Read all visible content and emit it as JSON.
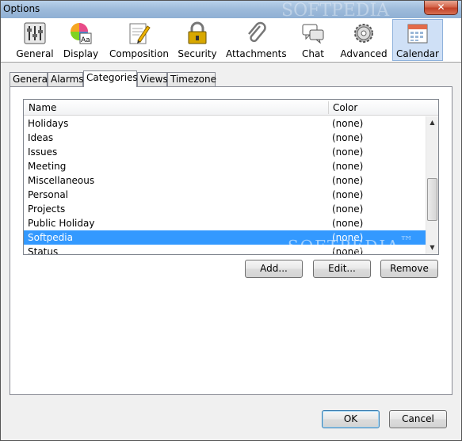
{
  "window": {
    "title": "Options",
    "close_glyph": "✕"
  },
  "toolbar": {
    "items": [
      {
        "label": "General",
        "icon": "sliders-icon"
      },
      {
        "label": "Display",
        "icon": "display-icon"
      },
      {
        "label": "Composition",
        "icon": "pencil-paper-icon"
      },
      {
        "label": "Security",
        "icon": "padlock-icon"
      },
      {
        "label": "Attachments",
        "icon": "paperclip-icon"
      },
      {
        "label": "Chat",
        "icon": "chat-bubbles-icon"
      },
      {
        "label": "Advanced",
        "icon": "gear-icon"
      },
      {
        "label": "Calendar",
        "icon": "calendar-icon"
      }
    ],
    "active": "Calendar",
    "display_icon_text": "Aa"
  },
  "tabs": {
    "items": [
      "General",
      "Alarms",
      "Categories",
      "Views",
      "Timezone"
    ],
    "selected": "Categories"
  },
  "categories": {
    "columns": {
      "name": "Name",
      "color": "Color"
    },
    "rows": [
      {
        "name": "Holidays",
        "color": "(none)"
      },
      {
        "name": "Ideas",
        "color": "(none)"
      },
      {
        "name": "Issues",
        "color": "(none)"
      },
      {
        "name": "Meeting",
        "color": "(none)"
      },
      {
        "name": "Miscellaneous",
        "color": "(none)"
      },
      {
        "name": "Personal",
        "color": "(none)"
      },
      {
        "name": "Projects",
        "color": "(none)"
      },
      {
        "name": "Public Holiday",
        "color": "(none)"
      },
      {
        "name": "Softpedia",
        "color": "(none)"
      },
      {
        "name": "Status",
        "color": "(none)"
      }
    ],
    "selected_row": "Softpedia",
    "scroll_up_glyph": "▲",
    "scroll_down_glyph": "▼"
  },
  "actions": {
    "add": "Add...",
    "edit": "Edit...",
    "remove": "Remove"
  },
  "footer": {
    "ok": "OK",
    "cancel": "Cancel"
  },
  "watermark": {
    "text": "SOFTPEDIA",
    "trademark": "™"
  },
  "colors": {
    "selection": "#3399ff",
    "active_toolbar": "#cfe0f6",
    "title_bar": "#9fbcdb",
    "close_button": "#c24128"
  }
}
